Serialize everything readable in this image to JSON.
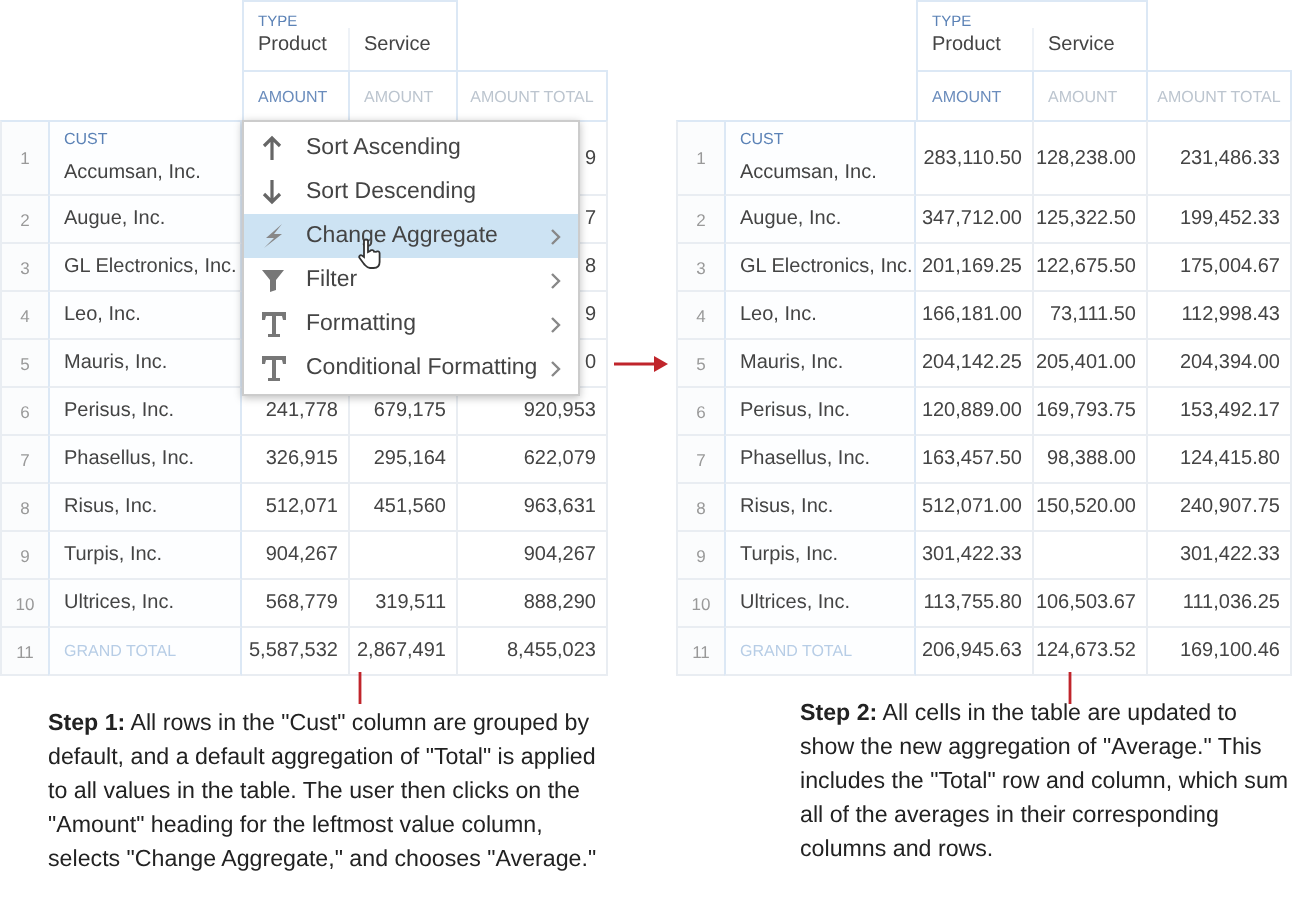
{
  "tables": [
    {
      "header": {
        "group_label": "TYPE",
        "type_columns": [
          "Product",
          "Service"
        ],
        "measures": [
          {
            "label": "AMOUNT",
            "active": true
          },
          {
            "label": "AMOUNT",
            "active": false
          },
          {
            "label": "AMOUNT TOTAL",
            "active": false
          }
        ],
        "row_label": "CUST"
      },
      "rows": [
        {
          "number": "1",
          "name": "Accumsan, Inc.",
          "total": "9"
        },
        {
          "number": "2",
          "name": "Augue, Inc.",
          "total": "7"
        },
        {
          "number": "3",
          "name": "GL Electronics, Inc.",
          "total": "8"
        },
        {
          "number": "4",
          "name": "Leo, Inc.",
          "total": "9"
        },
        {
          "number": "5",
          "name": "Mauris, Inc.",
          "total": "0"
        },
        {
          "number": "6",
          "name": "Perisus, Inc.",
          "product": "241,778",
          "service": "679,175",
          "total": "920,953"
        },
        {
          "number": "7",
          "name": "Phasellus, Inc.",
          "product": "326,915",
          "service": "295,164",
          "total": "622,079"
        },
        {
          "number": "8",
          "name": "Risus, Inc.",
          "product": "512,071",
          "service": "451,560",
          "total": "963,631"
        },
        {
          "number": "9",
          "name": "Turpis, Inc.",
          "product": "904,267",
          "total": "904,267"
        },
        {
          "number": "10",
          "name": "Ultrices, Inc.",
          "product": "568,779",
          "service": "319,511",
          "total": "888,290"
        },
        {
          "number": "11",
          "name": "GRAND TOTAL",
          "kind": "grand-total",
          "product": "5,587,532",
          "service": "2,867,491",
          "total": "8,455,023"
        }
      ],
      "context_menu": {
        "items": [
          {
            "label": "Sort Ascending",
            "submenu": false,
            "selected": false
          },
          {
            "label": "Sort Descending",
            "submenu": false,
            "selected": false
          },
          {
            "label": "Change Aggregate",
            "submenu": true,
            "selected": true
          },
          {
            "label": "Filter",
            "submenu": true,
            "selected": false
          },
          {
            "label": "Formatting",
            "submenu": true,
            "selected": false
          },
          {
            "label": "Conditional Formatting",
            "submenu": true,
            "selected": false
          }
        ]
      },
      "caption": "**Step 1:** All rows in the \"Cust\" column are grouped by default, and a default aggregation of \"Total\" is applied to all values in the table. The user then clicks on the \"Amount\" heading for the leftmost value column, selects \"Change Aggregate,\" and chooses \"Average.\""
    },
    {
      "header": {
        "group_label": "TYPE",
        "type_columns": [
          "Product",
          "Service"
        ],
        "measures": [
          {
            "label": "AMOUNT",
            "active": true
          },
          {
            "label": "AMOUNT",
            "active": false
          },
          {
            "label": "AMOUNT TOTAL",
            "active": false
          }
        ],
        "row_label": "CUST"
      },
      "rows": [
        {
          "number": "1",
          "name": "Accumsan, Inc.",
          "product": "283,110.50",
          "service": "128,238.00",
          "total": "231,486.33"
        },
        {
          "number": "2",
          "name": "Augue, Inc.",
          "product": "347,712.00",
          "service": "125,322.50",
          "total": "199,452.33"
        },
        {
          "number": "3",
          "name": "GL Electronics, Inc.",
          "product": "201,169.25",
          "service": "122,675.50",
          "total": "175,004.67"
        },
        {
          "number": "4",
          "name": "Leo, Inc.",
          "product": "166,181.00",
          "service": "73,111.50",
          "total": "112,998.43"
        },
        {
          "number": "5",
          "name": "Mauris, Inc.",
          "product": "204,142.25",
          "service": "205,401.00",
          "total": "204,394.00"
        },
        {
          "number": "6",
          "name": "Perisus, Inc.",
          "product": "120,889.00",
          "service": "169,793.75",
          "total": "153,492.17"
        },
        {
          "number": "7",
          "name": "Phasellus, Inc.",
          "product": "163,457.50",
          "service": "98,388.00",
          "total": "124,415.80"
        },
        {
          "number": "8",
          "name": "Risus, Inc.",
          "product": "512,071.00",
          "service": "150,520.00",
          "total": "240,907.75"
        },
        {
          "number": "9",
          "name": "Turpis, Inc.",
          "product": "301,422.33",
          "total": "301,422.33"
        },
        {
          "number": "10",
          "name": "Ultrices, Inc.",
          "product": "113,755.80",
          "service": "106,503.67",
          "total": "111,036.25"
        },
        {
          "number": "11",
          "name": "GRAND TOTAL",
          "kind": "grand-total",
          "product": "206,945.63",
          "service": "124,673.52",
          "total": "169,100.46"
        }
      ],
      "caption": "**Step 2:** All cells in the table are updated to show the new aggregation of \"Average.\" This includes the \"Total\" row and column, which sum all of the averages in their corresponding columns and rows."
    }
  ]
}
